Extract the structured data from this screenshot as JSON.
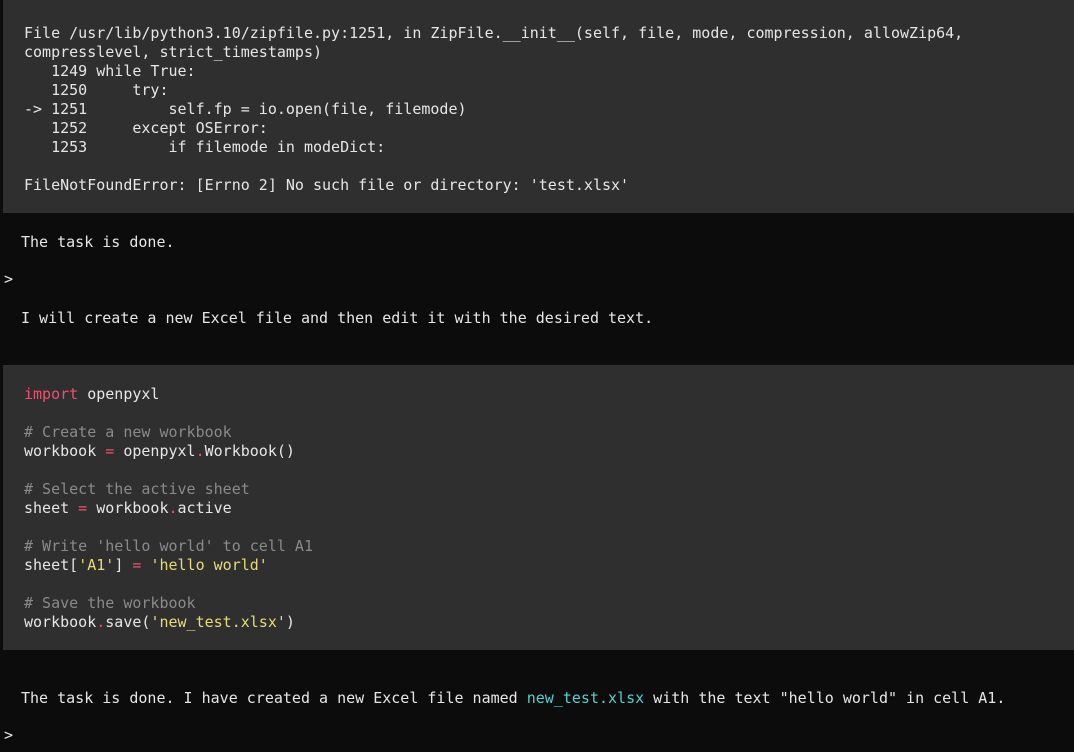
{
  "traceback": {
    "lines": [
      "File /usr/lib/python3.10/zipfile.py:1251, in ZipFile.__init__(self, file, mode, compression, allowZip64,",
      "compresslevel, strict_timestamps)",
      "   1249 while True:",
      "   1250     try:",
      "-> 1251         self.fp = io.open(file, filemode)",
      "   1252     except OSError:",
      "   1253         if filemode in modeDict:"
    ],
    "error": "FileNotFoundError: [Errno 2] No such file or directory: 'test.xlsx'"
  },
  "messages": {
    "task_done_1": "The task is done.",
    "prompt_symbol": ">",
    "plan": "I will create a new Excel file and then edit it with the desired text.",
    "final_prefix": "The task is done. I have created a new Excel file named ",
    "final_filename": "new_test.xlsx",
    "final_suffix": " with the text \"hello world\" in cell A1."
  },
  "code": {
    "import_kw": "import",
    "import_mod": " openpyxl",
    "comment_create": "# Create a new workbook",
    "wb_var": "workbook",
    "eq": " = ",
    "wb_ctor_mod": "openpyxl",
    "dot": ".",
    "wb_ctor": "Workbook()",
    "comment_select": "# Select the active sheet",
    "sheet_var": "sheet",
    "sheet_rhs_obj": "workbook",
    "sheet_rhs_attr": "active",
    "comment_write": "# Write 'hello world' to cell A1",
    "sheet_idx_open": "sheet[",
    "sheet_idx_key": "'A1'",
    "sheet_idx_close": "]",
    "hello_str": "'hello world'",
    "comment_save": "# Save the workbook",
    "save_obj": "workbook",
    "save_call_open": "save(",
    "save_arg": "'new_test.xlsx'",
    "save_call_close": ")"
  },
  "colors": {
    "background": "#0c0c0c",
    "block": "#2f2f2f",
    "keyword": "#f0506e",
    "comment": "#8a8a8a",
    "string": "#e6db74",
    "link": "#4fd2d2"
  }
}
